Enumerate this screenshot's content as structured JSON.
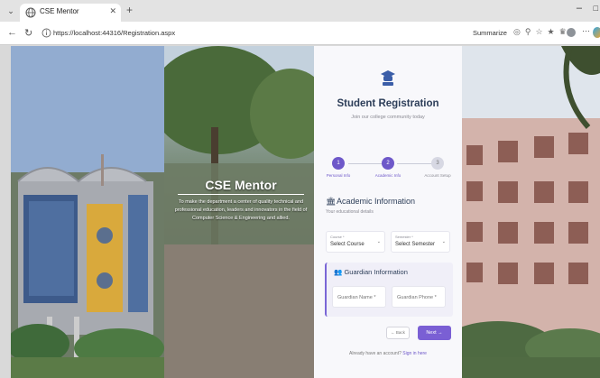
{
  "browser": {
    "tab_title": "CSE Mentor",
    "url": "https://localhost:44316/Registration.aspx",
    "summarize_label": "Summarize"
  },
  "hero": {
    "title": "CSE Mentor",
    "description": "To make the department a center of quality technical and professional education, leaders and innovators in the field of Computer Science & Engineering and allied."
  },
  "registration": {
    "title": "Student Registration",
    "subtitle": "Join our college community today",
    "steps": [
      {
        "number": "1",
        "label": "Personal Info",
        "state": "active"
      },
      {
        "number": "2",
        "label": "Academic Info",
        "state": "active"
      },
      {
        "number": "3",
        "label": "Account Setup",
        "state": "idle"
      }
    ],
    "academic": {
      "title": "Academic Information",
      "subtitle": "Your educational details",
      "course_caption": "Course *",
      "course_value": "Select Course",
      "semester_caption": "Semester *",
      "semester_value": "Select Semester"
    },
    "guardian": {
      "title": "Guardian Information",
      "name_placeholder": "Guardian Name *",
      "phone_placeholder": "Guardian Phone *"
    },
    "back_label": "← Back",
    "next_label": "Next →",
    "footer_text": "Already have an account?",
    "signin_label": "Sign in here"
  },
  "colors": {
    "accent": "#7a5fd4",
    "heading": "#2d3e59"
  }
}
